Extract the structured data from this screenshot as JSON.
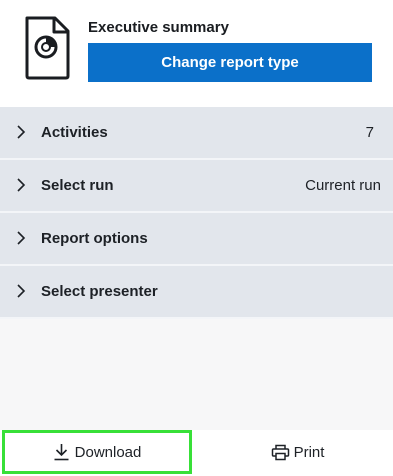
{
  "header": {
    "report_title": "Executive summary",
    "change_button_label": "Change report type",
    "accent_color": "#0b70c9"
  },
  "rows": [
    {
      "label": "Activities",
      "value": "7"
    },
    {
      "label": "Select run",
      "value": "Current run"
    },
    {
      "label": "Report options",
      "value": ""
    },
    {
      "label": "Select presenter",
      "value": ""
    }
  ],
  "footer": {
    "download_label": "Download",
    "print_label": "Print",
    "highlight_color": "#38e038"
  },
  "icons": {
    "report": "report-document-icon",
    "chevron": "chevron-right-icon",
    "download": "download-icon",
    "print": "printer-icon"
  }
}
